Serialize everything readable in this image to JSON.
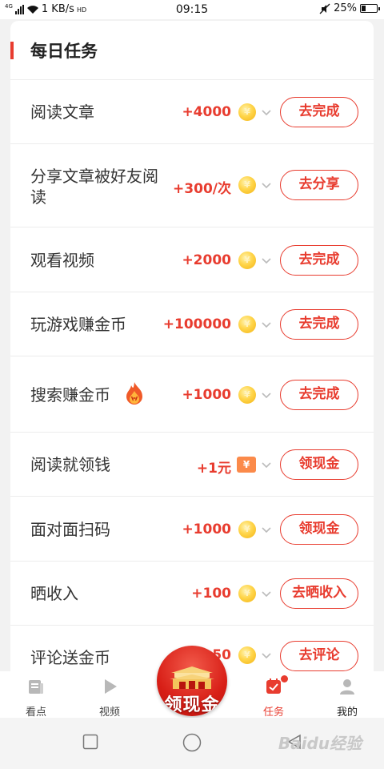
{
  "status_bar": {
    "network": "4G",
    "speed": "1 KB/s",
    "time": "09:15",
    "battery": "25%",
    "battery_level": 0.25
  },
  "section": {
    "title": "每日任务"
  },
  "tasks": [
    {
      "label": "阅读文章",
      "reward": "+4000",
      "icon": "coin-icon",
      "button": "去完成"
    },
    {
      "label": "分享文章被好友阅",
      "label2": "读",
      "reward": "+300/次",
      "icon": "coin-icon",
      "button": "去分享"
    },
    {
      "label": "观看视频",
      "reward": "+2000",
      "icon": "coin-icon",
      "button": "去完成"
    },
    {
      "label": "玩游戏赚金币",
      "reward": "+100000",
      "icon": "coin-icon",
      "button": "去完成"
    },
    {
      "label": "搜索赚金币",
      "reward": "+1000",
      "icon": "coin-icon",
      "button": "去完成",
      "extra_icon": "flame-icon"
    },
    {
      "label": "阅读就领钱",
      "reward": "+1元",
      "icon": "red-packet-icon",
      "icon_text": "¥",
      "button": "领现金"
    },
    {
      "label": "面对面扫码",
      "reward": "+1000",
      "icon": "coin-icon",
      "button": "领现金"
    },
    {
      "label": "晒收入",
      "reward": "+100",
      "icon": "coin-icon",
      "button": "去晒收入"
    },
    {
      "label": "评论送金币",
      "reward": "50",
      "icon": "coin-icon",
      "button": "去评论"
    }
  ],
  "coin_glyph": "¥",
  "bottom_nav": {
    "items": [
      {
        "label": "看点",
        "icon": "news-icon"
      },
      {
        "label": "视频",
        "icon": "play-icon"
      },
      {
        "label": "任务",
        "icon": "task-calendar-icon",
        "active": true
      },
      {
        "label": "我的",
        "icon": "user-icon"
      }
    ]
  },
  "promo": {
    "text": "领现金",
    "icon": "gate-icon"
  },
  "watermark": "Baidu经验",
  "colors": {
    "accent": "#e83c2f",
    "coin": "#ffd54a",
    "red_packet": "#fb8a4a"
  }
}
